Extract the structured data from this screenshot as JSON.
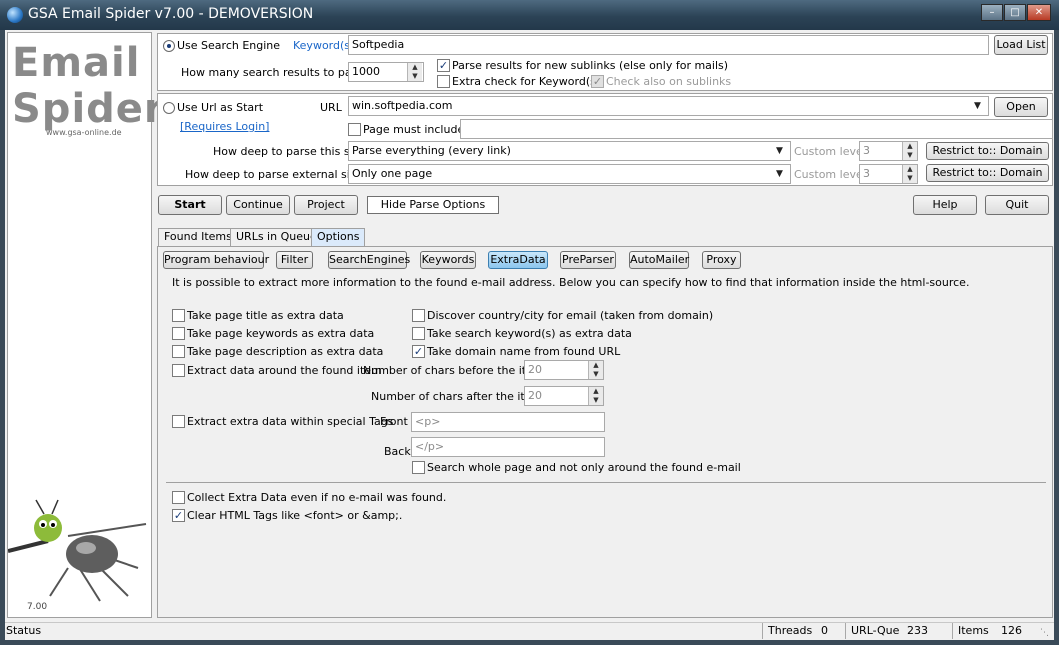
{
  "window": {
    "title": "GSA Email Spider v7.00 - DEMOVERSION"
  },
  "logo": {
    "line1": "Email",
    "line2": "Spider",
    "url": "www.gsa-online.de",
    "version": "7.00"
  },
  "search_engine": {
    "radio_label": "Use Search Engine",
    "keywords_label": "Keyword(s)",
    "keywords_value": "Softpedia",
    "load_list_label": "Load List",
    "results_label": "How many search results to parse",
    "results_value": "1000",
    "parse_sublinks_label": "Parse results for new sublinks (else only for mails)",
    "extra_check_label": "Extra check for Keyword(s)",
    "check_sublinks_label": "Check also on sublinks"
  },
  "url_start": {
    "radio_label": "Use Url as Start",
    "requires_login_label": "[Requires Login]",
    "url_label": "URL",
    "url_value": "win.softpedia.com",
    "open_label": "Open",
    "page_must_include_label": "Page must include",
    "page_must_include_value": "",
    "depth_site_label": "How deep to parse this site",
    "depth_site_value": "Parse everything (every link)",
    "depth_external_label": "How deep to parse external sites",
    "depth_external_value": "Only one page",
    "custom_level_label": "Custom level",
    "custom_level_1_value": "3",
    "custom_level_2_value": "3",
    "restrict_1_label": "Restrict to:: Domain",
    "restrict_2_label": "Restrict to:: Domain"
  },
  "actions": {
    "start": "Start",
    "continue": "Continue",
    "project": "Project",
    "hide_parse": "Hide Parse Options",
    "help": "Help",
    "quit": "Quit"
  },
  "tabs": [
    "Found Items",
    "URLs in Queue",
    "Options"
  ],
  "subtabs": [
    "Program behaviour",
    "Filter",
    "SearchEngines",
    "Keywords",
    "ExtraData",
    "PreParser",
    "AutoMailer",
    "Proxy"
  ],
  "extra": {
    "intro": "It is possible to extract more information to the found e-mail address. Below you can specify how to find that information inside the html-source.",
    "opt_title": "Take page title as extra data",
    "opt_keywords": "Take page keywords as extra data",
    "opt_description": "Take page description as extra data",
    "opt_around": "Extract data around the found item",
    "opt_country": "Discover country/city for email (taken from domain)",
    "opt_search_kw": "Take search keyword(s) as extra data",
    "opt_domain": "Take domain name from found URL",
    "chars_before_label": "Number of chars before the item",
    "chars_before_value": "20",
    "chars_after_label": "Number of chars after the item",
    "chars_after_value": "20",
    "opt_tags": "Extract extra data within special Tags",
    "front_label": "Front",
    "front_value": "<p>",
    "back_label": "Back",
    "back_value": "</p>",
    "opt_whole_page": "Search whole page and not only around the found e-mail",
    "opt_collect": "Collect Extra Data even if no  e-mail was found.",
    "opt_clear_html": "Clear HTML Tags like <font> or &amp;."
  },
  "statusbar": {
    "status": "Status",
    "threads_label": "Threads",
    "threads_value": "0",
    "urlque_label": "URL-Que",
    "urlque_value": "233",
    "items_label": "Items",
    "items_value": "126"
  }
}
